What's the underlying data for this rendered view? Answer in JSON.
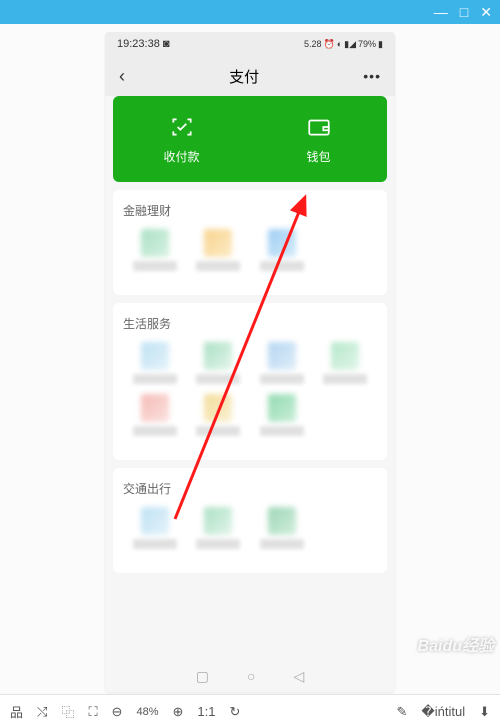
{
  "window": {
    "minimize": "—",
    "maximize": "□",
    "close": "✕"
  },
  "status": {
    "time": "19:23:38",
    "date_small": "5.28",
    "battery": "79%"
  },
  "nav": {
    "back": "‹",
    "title": "支付",
    "more": "•••"
  },
  "hero": {
    "pay": "收付款",
    "wallet": "钱包"
  },
  "sections": {
    "finance": {
      "title": "金融理财"
    },
    "life": {
      "title": "生活服务"
    },
    "transport": {
      "title": "交通出行"
    }
  },
  "toolbar": {
    "zoom": "48%"
  },
  "watermark": "Baidu经验"
}
